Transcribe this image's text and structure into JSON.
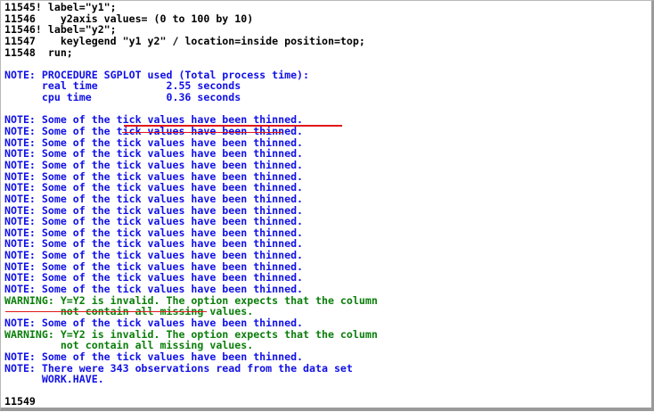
{
  "log": {
    "lines": [
      {
        "text": "11545! label=\"y1\";",
        "color": "black"
      },
      {
        "text": "11546    y2axis values= (0 to 100 by 10)",
        "color": "black"
      },
      {
        "text": "11546! label=\"y2\";",
        "color": "black"
      },
      {
        "text": "11547    keylegend \"y1 y2\" / location=inside position=top;",
        "color": "black"
      },
      {
        "text": "11548  run;",
        "color": "black"
      },
      {
        "text": "",
        "color": "black"
      },
      {
        "text": "NOTE: PROCEDURE SGPLOT used (Total process time):",
        "color": "blue"
      },
      {
        "text": "      real time           2.55 seconds",
        "color": "blue"
      },
      {
        "text": "      cpu time            0.36 seconds",
        "color": "blue"
      },
      {
        "text": "",
        "color": "blue"
      },
      {
        "text": "NOTE: Some of the tick values have been thinned.",
        "color": "blue"
      },
      {
        "text": "NOTE: Some of the tick values have been thinned.",
        "color": "blue"
      },
      {
        "text": "NOTE: Some of the tick values have been thinned.",
        "color": "blue"
      },
      {
        "text": "NOTE: Some of the tick values have been thinned.",
        "color": "blue"
      },
      {
        "text": "NOTE: Some of the tick values have been thinned.",
        "color": "blue"
      },
      {
        "text": "NOTE: Some of the tick values have been thinned.",
        "color": "blue"
      },
      {
        "text": "NOTE: Some of the tick values have been thinned.",
        "color": "blue"
      },
      {
        "text": "NOTE: Some of the tick values have been thinned.",
        "color": "blue"
      },
      {
        "text": "NOTE: Some of the tick values have been thinned.",
        "color": "blue"
      },
      {
        "text": "NOTE: Some of the tick values have been thinned.",
        "color": "blue"
      },
      {
        "text": "NOTE: Some of the tick values have been thinned.",
        "color": "blue"
      },
      {
        "text": "NOTE: Some of the tick values have been thinned.",
        "color": "blue"
      },
      {
        "text": "NOTE: Some of the tick values have been thinned.",
        "color": "blue"
      },
      {
        "text": "NOTE: Some of the tick values have been thinned.",
        "color": "blue"
      },
      {
        "text": "NOTE: Some of the tick values have been thinned.",
        "color": "blue"
      },
      {
        "text": "NOTE: Some of the tick values have been thinned.",
        "color": "blue"
      },
      {
        "text": "WARNING: Y=Y2 is invalid. The option expects that the column",
        "color": "green"
      },
      {
        "text": "         not contain all missing values.",
        "color": "green"
      },
      {
        "text": "NOTE: Some of the tick values have been thinned.",
        "color": "blue"
      },
      {
        "text": "WARNING: Y=Y2 is invalid. The option expects that the column",
        "color": "green"
      },
      {
        "text": "         not contain all missing values.",
        "color": "green"
      },
      {
        "text": "NOTE: Some of the tick values have been thinned.",
        "color": "blue"
      },
      {
        "text": "NOTE: There were 343 observations read from the data set",
        "color": "blue"
      },
      {
        "text": "      WORK.HAVE.",
        "color": "blue"
      },
      {
        "text": "",
        "color": "black"
      },
      {
        "text": "11549",
        "color": "black"
      }
    ]
  },
  "colors": {
    "black": "#000000",
    "blue": "#1010e8",
    "green": "#0a7e0a",
    "annotation": "#e01818"
  }
}
